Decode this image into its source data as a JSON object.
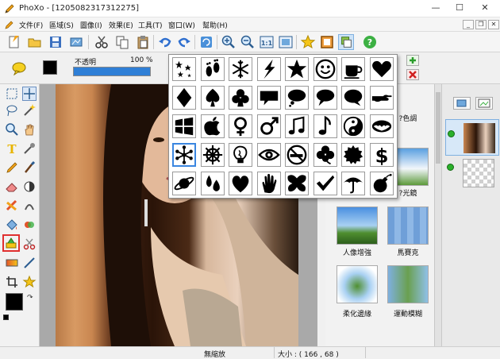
{
  "window": {
    "title": "PhoXo - [1205082317312275]",
    "minimize_glyph": "—",
    "maximize_glyph": "☐",
    "close_glyph": "✕"
  },
  "menu": {
    "items": [
      "文件(F)",
      "區域(S)",
      "圖像(I)",
      "效果(E)",
      "工具(T)",
      "窗口(W)",
      "幫助(H)"
    ],
    "mdi_minimize": "_",
    "mdi_restore": "❐",
    "mdi_close": "✕"
  },
  "options": {
    "opacity_label": "不透明",
    "opacity_value": "100 %",
    "opacity_fraction": 1.0
  },
  "toolbar_icons": [
    "new-file-icon",
    "open-folder-icon",
    "save-icon",
    "export-icon",
    "cut-icon",
    "copy-icon",
    "paste-icon",
    "undo-icon",
    "redo-icon",
    "refresh-icon",
    "zoom-in-icon",
    "zoom-out-icon",
    "actual-size-icon",
    "fit-screen-icon",
    "favorite-star-icon",
    "frame-icon",
    "layers-panel-icon",
    "help-icon"
  ],
  "shapes": {
    "rows": [
      [
        "stars",
        "footprints",
        "snowflake",
        "lightning",
        "star",
        "smiley",
        "coffee-cup",
        "heart"
      ],
      [
        "diamond",
        "spade",
        "club",
        "speech-bubble",
        "thought-bubble",
        "oval-speech",
        "round-speech",
        "pointing-hand"
      ],
      [
        "windows-logo",
        "apple-logo",
        "female-symbol",
        "male-symbol",
        "double-note",
        "single-note",
        "yin-yang",
        "bat"
      ],
      [
        "asterisk-network",
        "ship-wheel",
        "lightbulb",
        "eye",
        "no-smoking",
        "shamrock",
        "seal",
        "dollar-sign"
      ],
      [
        "saturn",
        "drops",
        "rounded-heart",
        "hand-print",
        "butterfly",
        "checkmark",
        "umbrella",
        "bomb"
      ]
    ],
    "selected": "asterisk-network"
  },
  "effects": {
    "items": [
      {
        "name": "?色調"
      },
      {
        "name": "?光鏡"
      },
      {
        "name": "人像增強"
      },
      {
        "name": "馬賽克"
      },
      {
        "name": "柔化邊緣"
      },
      {
        "name": "運動模糊"
      }
    ]
  },
  "status": {
    "zoom_text": "無縮放",
    "size_label": "大小 : ( 166 , 68 )"
  },
  "colors": {
    "accent_selection": "#3a86e0",
    "opacity_bar": "#2f7fd6",
    "highlight_tool": "#e03030",
    "foreground": "#000000",
    "background": "#ffffff"
  }
}
